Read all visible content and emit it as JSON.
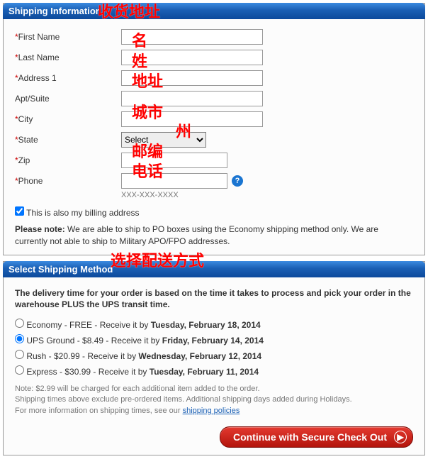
{
  "shipping_panel": {
    "title": "Shipping Information",
    "fields": {
      "first_name": {
        "label": "First Name",
        "required": true,
        "value": ""
      },
      "last_name": {
        "label": "Last Name",
        "required": true,
        "value": ""
      },
      "address1": {
        "label": "Address 1",
        "required": true,
        "value": ""
      },
      "apt": {
        "label": "Apt/Suite",
        "required": false,
        "value": ""
      },
      "city": {
        "label": "City",
        "required": true,
        "value": ""
      },
      "state": {
        "label": "State",
        "required": true,
        "selected": "Select"
      },
      "zip": {
        "label": "Zip",
        "required": true,
        "value": ""
      },
      "phone": {
        "label": "Phone",
        "required": true,
        "value": "",
        "hint": "XXX-XXX-XXXX"
      }
    },
    "billing_same": {
      "label": "This is also my billing address",
      "checked": true
    },
    "note_prefix": "Please note:",
    "note_text": " We are able to ship to PO boxes using the Economy shipping method only. We are currently not able to ship to Military APO/FPO addresses."
  },
  "method_panel": {
    "title": "Select Shipping Method",
    "intro": "The delivery time for your order is based on the time it takes to process and pick your order in the warehouse PLUS the UPS transit time.",
    "options": [
      {
        "prefix": "Economy - FREE - Receive it by ",
        "date": "Tuesday, February 18, 2014",
        "checked": false
      },
      {
        "prefix": "UPS Ground - $8.49 - Receive it by ",
        "date": "Friday, February 14, 2014",
        "checked": true
      },
      {
        "prefix": "Rush - $20.99 - Receive it by ",
        "date": "Wednesday, February 12, 2014",
        "checked": false
      },
      {
        "prefix": "Express - $30.99 - Receive it by ",
        "date": "Tuesday, February 11, 2014",
        "checked": false
      }
    ],
    "footnote1": "Note: $2.99 will be charged for each additional item added to the order.",
    "footnote2": "Shipping times above exclude pre-ordered items. Additional shipping days added during Holidays.",
    "footnote3_pre": "For more information on shipping times, see our ",
    "footnote3_link": "shipping policies"
  },
  "cta_label": "Continue with Secure Check Out",
  "annotations": {
    "panel1": "收货地址",
    "first_name": "名",
    "last_name": "姓",
    "address": "地址",
    "city": "城市",
    "state": "州",
    "zip": "邮编",
    "phone": "电话",
    "panel2": "选择配送方式"
  }
}
